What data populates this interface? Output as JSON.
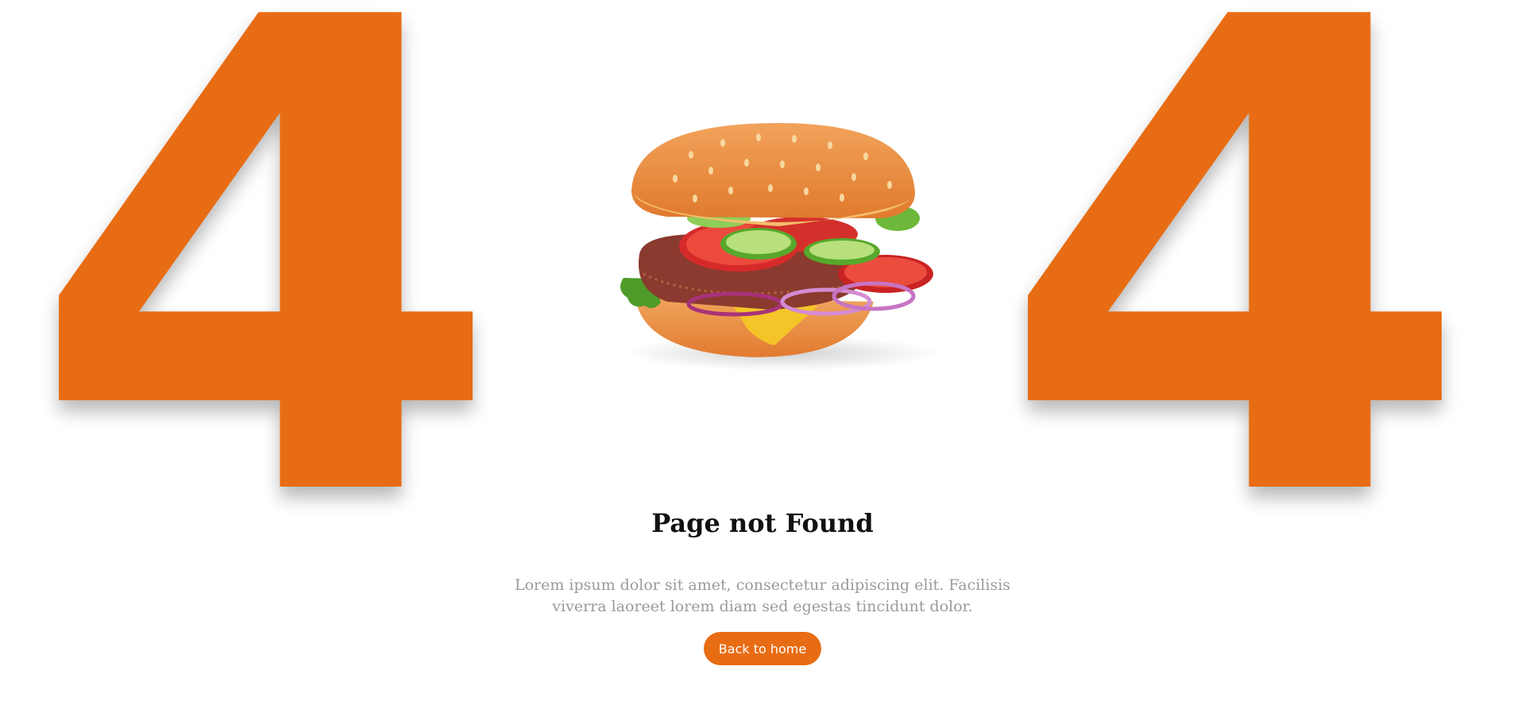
{
  "error": {
    "digit_left": "4",
    "digit_right": "4",
    "zero_illustration": "burger"
  },
  "content": {
    "title": "Page not Found",
    "description": "Lorem ipsum dolor sit amet, consectetur adipiscing elit. Facilisis viverra laoreet lorem diam sed egestas tincidunt dolor.",
    "button_label": "Back to home"
  },
  "colors": {
    "accent": "#e86c13",
    "title_text": "#111111",
    "body_text": "#9a9a9a",
    "background": "#ffffff"
  }
}
